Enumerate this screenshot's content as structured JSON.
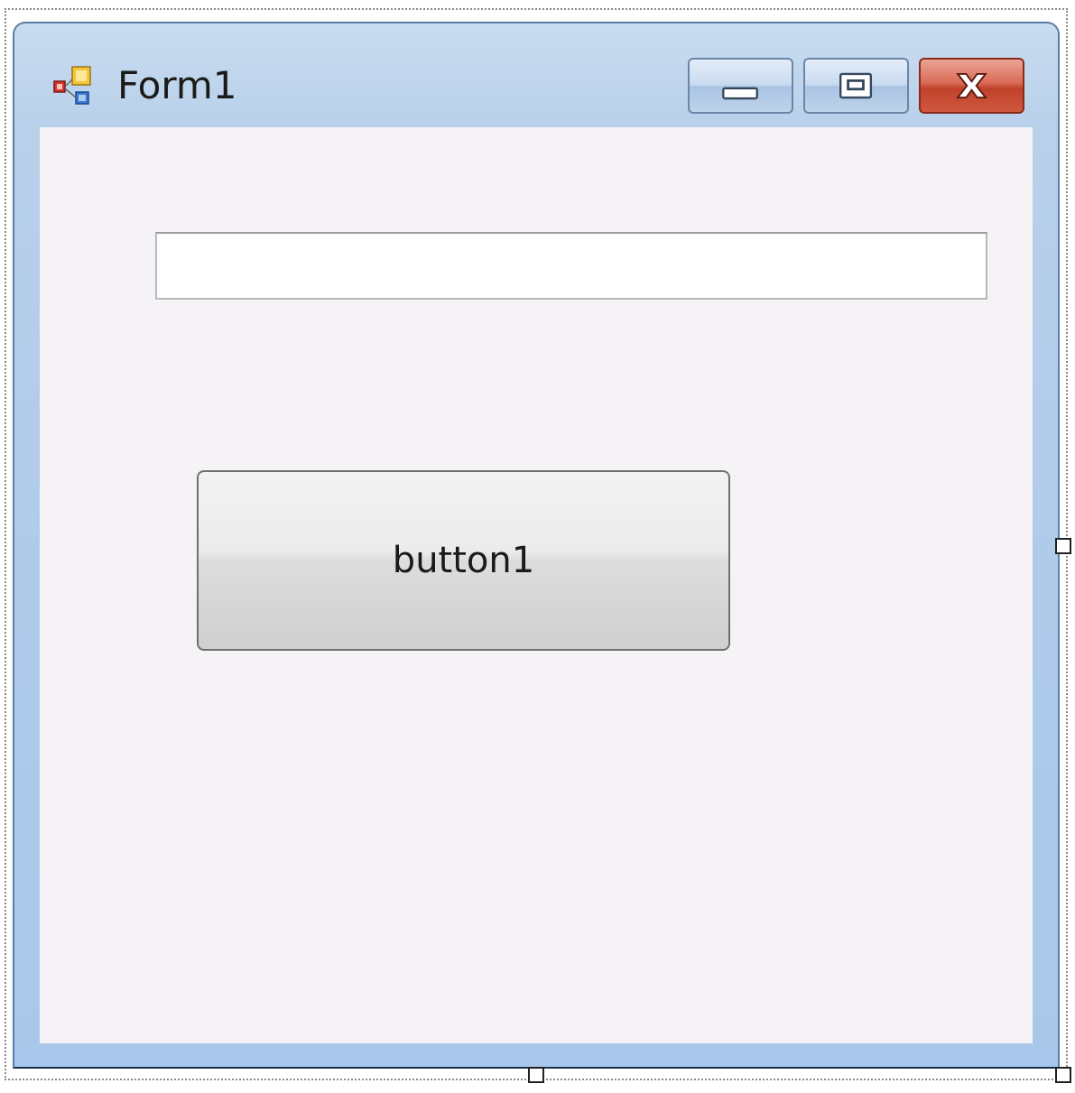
{
  "window": {
    "title": "Form1",
    "icon": "winforms-app-icon",
    "caption_buttons": {
      "minimize_icon": "minimize-icon",
      "maximize_icon": "maximize-icon",
      "close_icon": "close-icon"
    }
  },
  "form": {
    "textbox": {
      "value": "",
      "placeholder": ""
    },
    "button1": {
      "label": "button1"
    }
  },
  "colors": {
    "client_background": "#f6f3f6",
    "frame_accent": "#b2ccea",
    "close_button": "#c0412a"
  }
}
